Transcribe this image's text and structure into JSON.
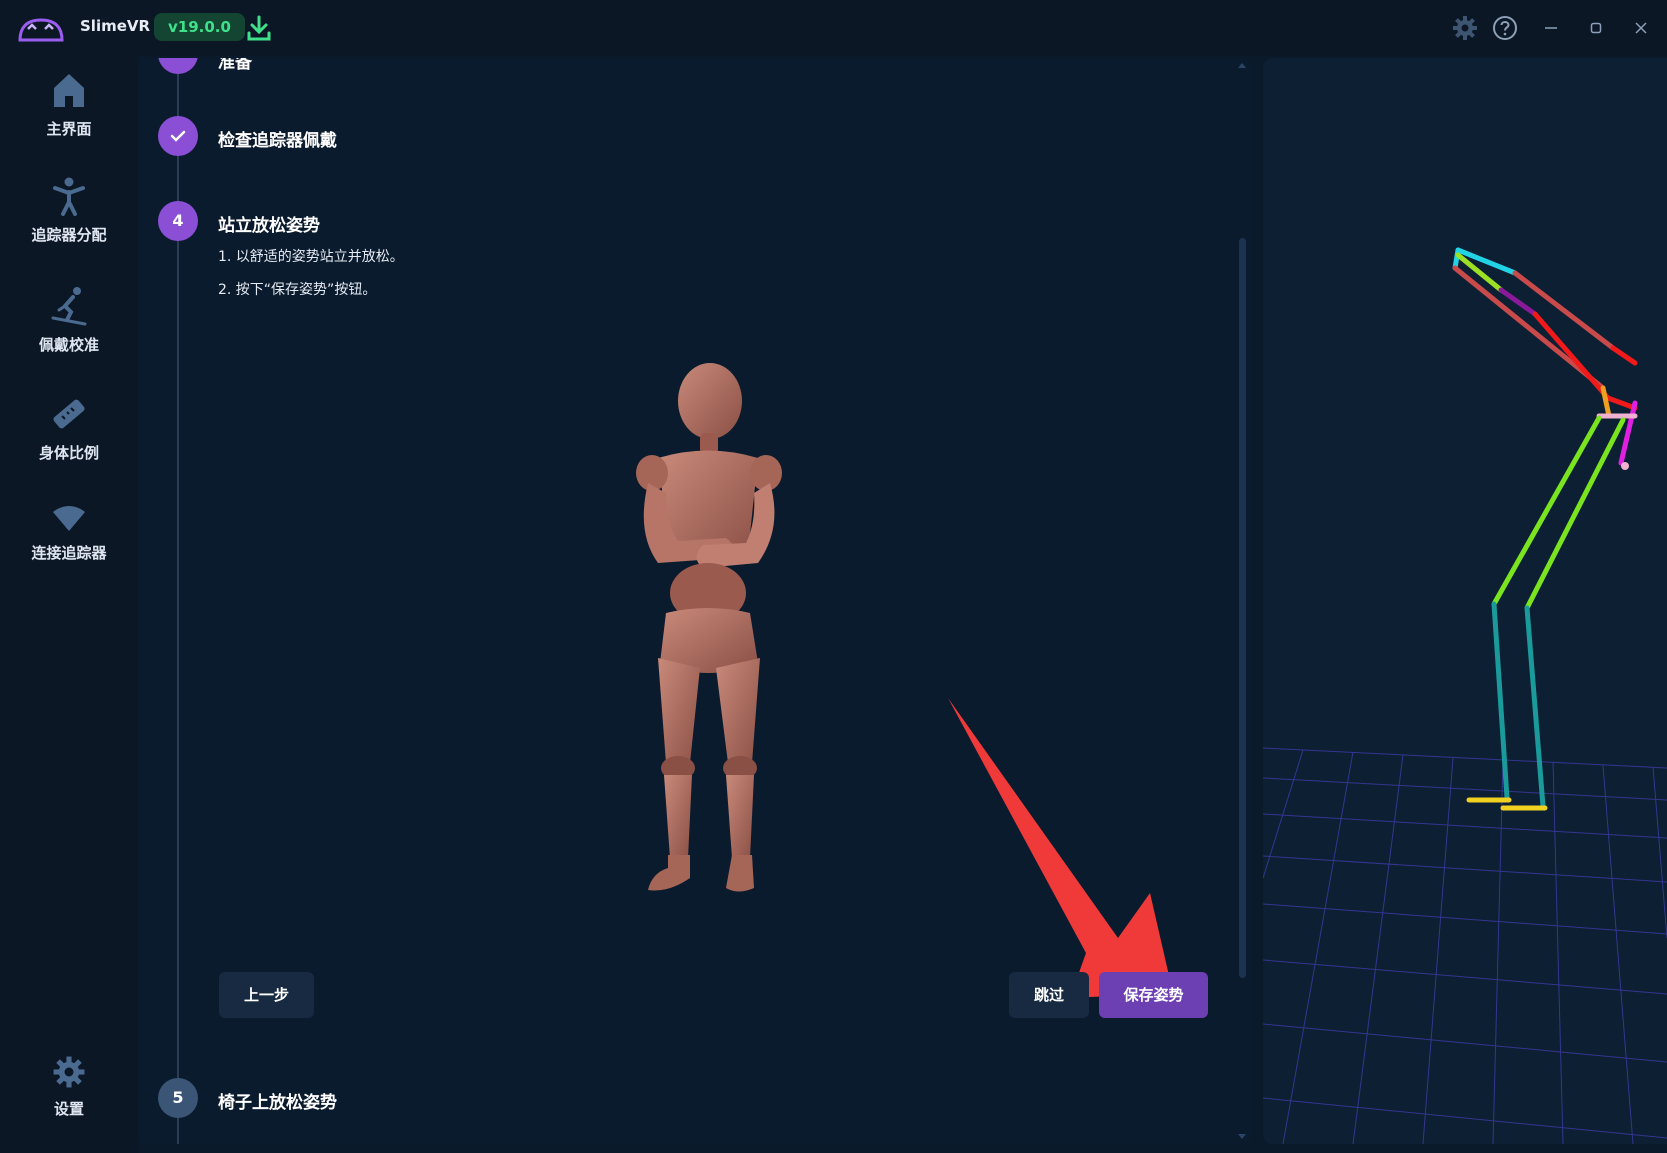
{
  "app": {
    "name": "SlimeVR",
    "version": "v19.0.0"
  },
  "colors": {
    "accent": "#8b4fd6",
    "version_badge_bg": "#134532",
    "version_badge_text": "#3fe08a",
    "primary_button": "#6c3fb3"
  },
  "sidebar": {
    "items": [
      {
        "label": "主界面",
        "icon": "home-icon"
      },
      {
        "label": "追踪器分配",
        "icon": "person-icon"
      },
      {
        "label": "佩戴校准",
        "icon": "skier-icon"
      },
      {
        "label": "身体比例",
        "icon": "ruler-icon"
      },
      {
        "label": "连接追踪器",
        "icon": "wifi-icon"
      }
    ],
    "settings_label": "设置"
  },
  "steps": {
    "previous_partial": "准备",
    "check": {
      "title": "检查追踪器佩戴"
    },
    "current": {
      "number": "4",
      "title": "站立放松姿势",
      "instructions": [
        "1. 以舒适的姿势站立并放松。",
        "2. 按下“保存姿势”按钮。"
      ]
    },
    "next": {
      "number": "5",
      "title": "椅子上放松姿势"
    }
  },
  "buttons": {
    "back": "上一步",
    "skip": "跳过",
    "save_pose": "保存姿势"
  }
}
